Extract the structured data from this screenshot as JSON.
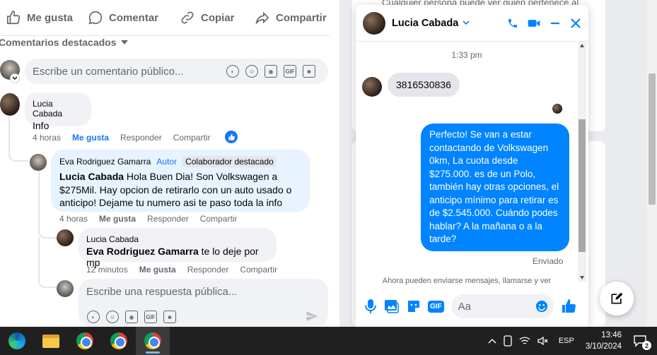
{
  "feed": {
    "actions": {
      "like": "Me gusta",
      "comment": "Comentar",
      "copy": "Copiar",
      "share": "Compartir"
    },
    "featured_label": "Comentarios destacados",
    "comment_placeholder": "Escribe un comentario público...",
    "reply_placeholder": "Escribe una respuesta pública...",
    "comments": [
      {
        "author": "Lucia Cabada",
        "text": "Info",
        "time": "4 horas",
        "like": "Me gusta",
        "reply": "Responder",
        "share": "Compartir"
      },
      {
        "author": "Eva Rodriguez Gamarra",
        "badge_author": "Autor",
        "badge_featured": "Colaborador destacado",
        "mention": "Lucia Cabada",
        "text": " Hola Buen Dia! Son Volkswagen a $275Mil. Hay opcion de retirarlo con un auto usado o anticipo! Dejame tu numero asi te paso toda la info",
        "time": "4 horas",
        "like": "Me gusta",
        "reply": "Responder",
        "share": "Compartir"
      },
      {
        "author": "Lucia Cabada",
        "mention": "Eva Rodriguez Gamarra",
        "text": " te lo deje por mp",
        "time": "12 minutos",
        "like": "Me gusta",
        "reply": "Responder",
        "share": "Compartir"
      }
    ]
  },
  "background": {
    "top_text": "Cualquier persona puede ver quién pertenece al"
  },
  "chat": {
    "contact": "Lucia Cabada",
    "time": "1:33 pm",
    "incoming": "3816530836",
    "outgoing": "Perfecto!  Se van a estar contactando de Volkswagen 0km, La cuota desde $275.000. es de un Polo, también hay otras opciones, el anticipo mínimo para retirar es de $2.545.000. Cuándo podes hablar? A la mañana o a la tarde?",
    "status": "Enviado",
    "notice": "Ahora pueden enviarse mensajes, llamarse y ver",
    "input_placeholder": "Aa",
    "accent": "#0084ff"
  },
  "taskbar": {
    "language": "ESP",
    "time": "13:46",
    "date": "3/10/2024",
    "notif_count": "2"
  }
}
